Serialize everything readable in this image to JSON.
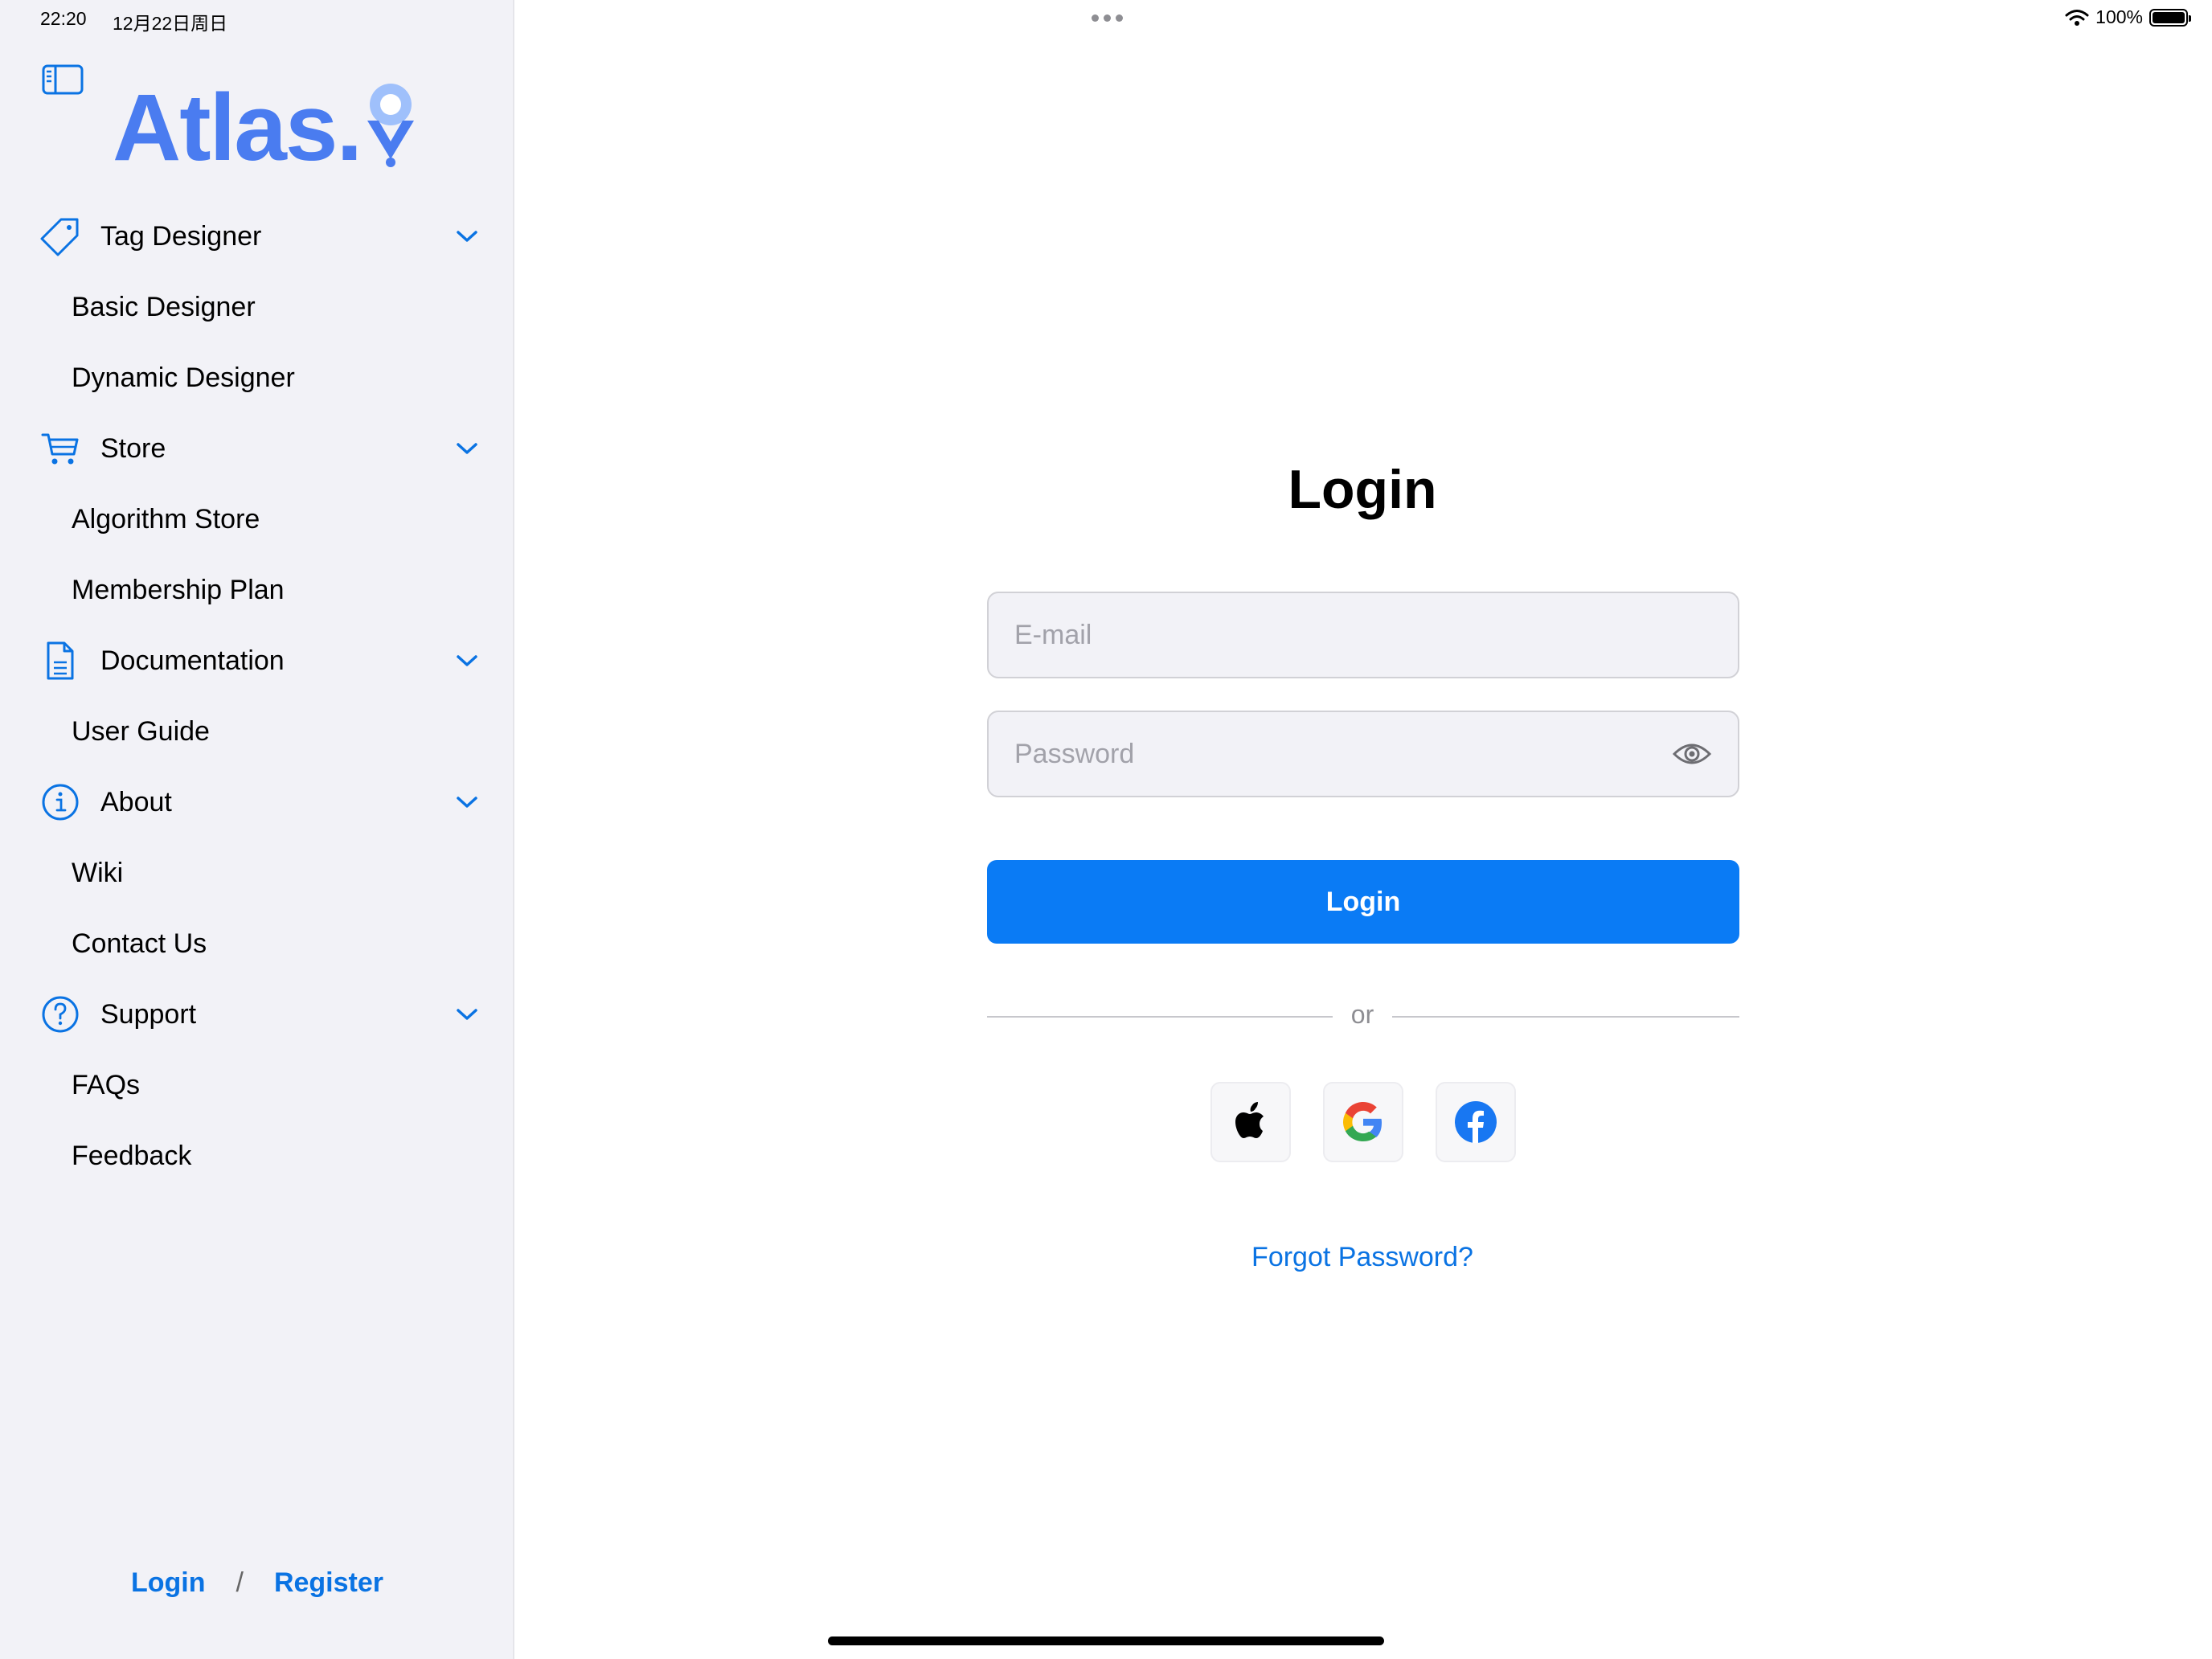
{
  "status_bar": {
    "time": "22:20",
    "date": "12月22日周日",
    "battery": "100%"
  },
  "sidebar": {
    "logo_text": "Atlas.",
    "sections": [
      {
        "label": "Tag Designer",
        "icon": "tag-icon",
        "items": [
          "Basic Designer",
          "Dynamic Designer"
        ]
      },
      {
        "label": "Store",
        "icon": "cart-icon",
        "items": [
          "Algorithm Store",
          "Membership Plan"
        ]
      },
      {
        "label": "Documentation",
        "icon": "document-icon",
        "items": [
          "User Guide"
        ]
      },
      {
        "label": "About",
        "icon": "info-icon",
        "items": [
          "Wiki",
          "Contact Us"
        ]
      },
      {
        "label": "Support",
        "icon": "question-icon",
        "items": [
          "FAQs",
          "Feedback"
        ]
      }
    ],
    "auth": {
      "login": "Login",
      "separator": "/",
      "register": "Register"
    }
  },
  "main": {
    "title": "Login",
    "email_placeholder": "E-mail",
    "password_placeholder": "Password",
    "login_button": "Login",
    "divider_text": "or",
    "social": [
      "apple-icon",
      "google-icon",
      "facebook-icon"
    ],
    "forgot_password": "Forgot Password?"
  },
  "colors": {
    "accent": "#0a7bf5",
    "link": "#0a73e3",
    "logo": "#4a7cf0",
    "sidebar_bg": "#f2f2f7"
  }
}
